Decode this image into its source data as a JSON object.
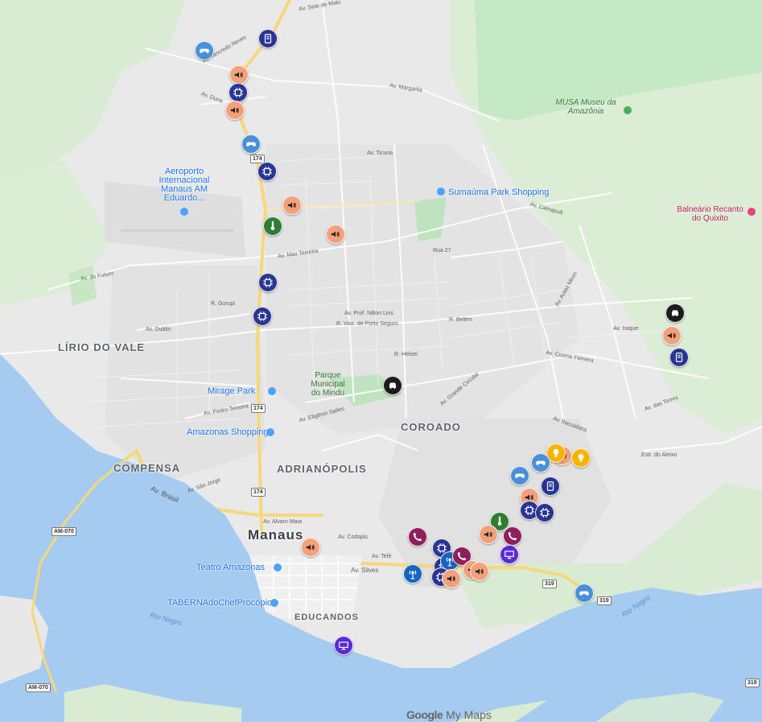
{
  "map": {
    "brand": {
      "google": "Google",
      "product": "My Maps"
    },
    "districts": [
      "LÍRIO DO VALE",
      "COMPENSA",
      "ADRIANÓPOLIS",
      "COROADO",
      "EDUCANDOS"
    ],
    "city": "Manaus",
    "pois": {
      "airport": "Aeroporto Internacional Manaus AM Eduardo...",
      "sumauma": "Sumaúma Park Shopping",
      "museu": "MUSA Museu da Amazônia",
      "balneario": "Balneário Recanto do Quixito",
      "parque": "Parque Municipal do Mindu",
      "mirage": "Mirage Park",
      "amazonas_shopping": "Amazonas Shopping",
      "teatro": "Teatro Amazonas",
      "taberna": "TABERNAdoChefProcópio"
    },
    "rivers": [
      "Rio Negro",
      "Rio Negro"
    ],
    "highways": [
      "AM-070",
      "AM-070",
      "174",
      "174",
      "174",
      "319",
      "319",
      "319"
    ],
    "streets": [
      "Av. Sete de Maio",
      "Av. Margarita",
      "Av. Tancredo Neves",
      "Av. Ticuna",
      "Av. Max Teixeira",
      "Av. Prof. Nilton Lins",
      "R. Visc. de Porto Seguro",
      "Av. do Futuro",
      "Av. Brasil",
      "Av. Silves",
      "Av. Alvaro Maia",
      "Av. Camapuã",
      "Av. Cosme Ferreira",
      "Av. Autaz Mirim",
      "Av. Iraque",
      "Av. Itacoatiara",
      "R. Gurupi",
      "Av. Dublin",
      "Av. das Torres",
      "Rua 27",
      "Av. Efigênio Salles",
      "Av. Pedro Teixeira",
      "Av. Duna",
      "Av. Tefé",
      "Av. Codajás",
      "Av. São Jorge",
      "R. Belém",
      "Av. Grande Circular",
      "R. Heloei",
      "Estr. do Aleixo"
    ],
    "markers": [
      {
        "cat": "games",
        "color": "#4a90d9"
      },
      {
        "cat": "mobile",
        "color": "#283593"
      },
      {
        "cat": "sound",
        "color": "#f4a07a"
      },
      {
        "cat": "chip",
        "color": "#283593"
      },
      {
        "cat": "sound",
        "color": "#f4a07a"
      },
      {
        "cat": "games",
        "color": "#4a90d9"
      },
      {
        "cat": "chip",
        "color": "#283593"
      },
      {
        "cat": "sound",
        "color": "#f4a07a"
      },
      {
        "cat": "temp",
        "color": "#2e7d32"
      },
      {
        "cat": "sound",
        "color": "#f4a07a"
      },
      {
        "cat": "chip",
        "color": "#283593"
      },
      {
        "cat": "chip",
        "color": "#283593"
      },
      {
        "cat": "car",
        "color": "#1c1c1c"
      },
      {
        "cat": "car",
        "color": "#1c1c1c"
      },
      {
        "cat": "sound",
        "color": "#f4a07a"
      },
      {
        "cat": "mobile",
        "color": "#283593"
      },
      {
        "cat": "games",
        "color": "#4a90d9"
      },
      {
        "cat": "sound",
        "color": "#f4a07a"
      },
      {
        "cat": "bulb",
        "color": "#f5b400"
      },
      {
        "cat": "bulb",
        "color": "#f5b400"
      },
      {
        "cat": "games",
        "color": "#4a90d9"
      },
      {
        "cat": "sound",
        "color": "#f4a07a"
      },
      {
        "cat": "mobile",
        "color": "#283593"
      },
      {
        "cat": "chip",
        "color": "#283593"
      },
      {
        "cat": "chip",
        "color": "#283593"
      },
      {
        "cat": "temp",
        "color": "#2e7d32"
      },
      {
        "cat": "sound",
        "color": "#f4a07a"
      },
      {
        "cat": "phone",
        "color": "#8e1e5c"
      },
      {
        "cat": "chip",
        "color": "#283593"
      },
      {
        "cat": "monitor",
        "color": "#5a2bd8"
      },
      {
        "cat": "phone",
        "color": "#8e1e5c"
      },
      {
        "cat": "chip",
        "color": "#283593"
      },
      {
        "cat": "antenna",
        "color": "#1565c0"
      },
      {
        "cat": "phone",
        "color": "#8e1e5c"
      },
      {
        "cat": "sound",
        "color": "#f4a07a"
      },
      {
        "cat": "sound",
        "color": "#f4a07a"
      },
      {
        "cat": "chip",
        "color": "#283593"
      },
      {
        "cat": "sound",
        "color": "#f4a07a"
      },
      {
        "cat": "antenna",
        "color": "#1565c0"
      },
      {
        "cat": "games",
        "color": "#4a90d9"
      },
      {
        "cat": "sound",
        "color": "#f4a07a"
      },
      {
        "cat": "monitor",
        "color": "#5a2bd8"
      }
    ]
  }
}
